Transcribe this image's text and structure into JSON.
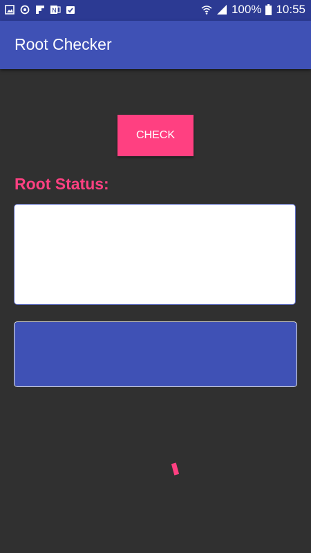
{
  "status_bar": {
    "left_icons": [
      "gallery-icon",
      "sync-icon",
      "flipboard-icon",
      "onenote-icon",
      "clipboard-check-icon"
    ],
    "right_icons": [
      "wifi-icon",
      "signal-icon"
    ],
    "battery": "100%",
    "time": "10:55"
  },
  "app_bar": {
    "title": "Root Checker"
  },
  "main": {
    "check_button": "CHECK",
    "root_status_label": "Root Status:",
    "status_output": ""
  },
  "colors": {
    "primary": "#3f51b5",
    "primary_dark": "#2c3a93",
    "accent": "#ff4081",
    "background": "#303030"
  }
}
